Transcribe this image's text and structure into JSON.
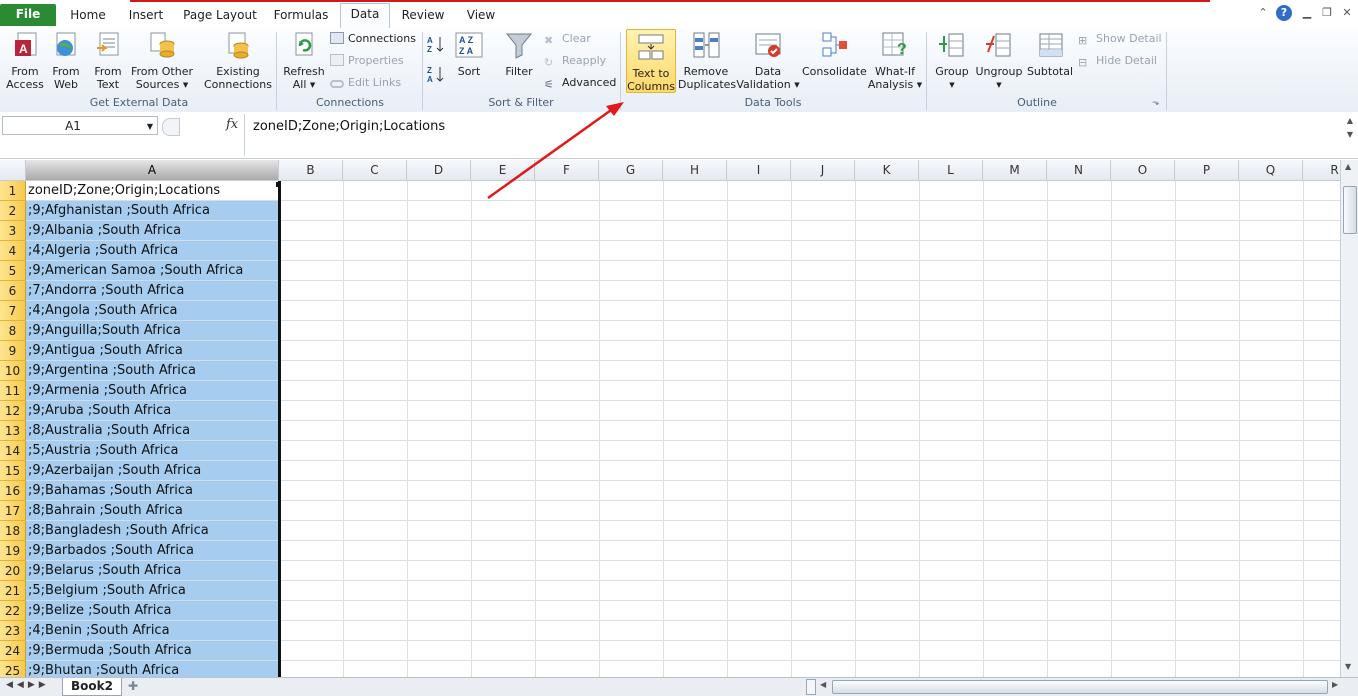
{
  "tabs": [
    {
      "label": "File"
    },
    {
      "label": "Home"
    },
    {
      "label": "Insert"
    },
    {
      "label": "Page Layout"
    },
    {
      "label": "Formulas"
    },
    {
      "label": "Data"
    },
    {
      "label": "Review"
    },
    {
      "label": "View"
    }
  ],
  "ribbon": {
    "external": {
      "from_access_1": "From",
      "from_access_2": "Access",
      "from_web_1": "From",
      "from_web_2": "Web",
      "from_text_1": "From",
      "from_text_2": "Text",
      "from_other_1": "From Other",
      "from_other_2": "Sources",
      "existing_1": "Existing",
      "existing_2": "Connections",
      "label": "Get External Data"
    },
    "connections": {
      "refresh_1": "Refresh",
      "refresh_2": "All",
      "connections": "Connections",
      "properties": "Properties",
      "edit_links": "Edit Links",
      "label": "Connections"
    },
    "sort": {
      "sort": "Sort",
      "filter": "Filter",
      "clear": "Clear",
      "reapply": "Reapply",
      "advanced": "Advanced",
      "label": "Sort & Filter"
    },
    "tools": {
      "ttc_1": "Text to",
      "ttc_2": "Columns",
      "rd_1": "Remove",
      "rd_2": "Duplicates",
      "dv_1": "Data",
      "dv_2": "Validation",
      "consolidate": "Consolidate",
      "wi_1": "What-If",
      "wi_2": "Analysis",
      "label": "Data Tools"
    },
    "outline": {
      "group": "Group",
      "ungroup": "Ungroup",
      "subtotal": "Subtotal",
      "show_detail": "Show Detail",
      "hide_detail": "Hide Detail",
      "label": "Outline"
    }
  },
  "formula_bar": {
    "name_box": "A1",
    "fx": "fx",
    "formula": "zoneID;Zone;Origin;Locations"
  },
  "columns": [
    "A",
    "B",
    "C",
    "D",
    "E",
    "F",
    "G",
    "H",
    "I",
    "J",
    "K",
    "L",
    "M",
    "N",
    "O",
    "P",
    "Q",
    "R"
  ],
  "rows": [
    {
      "n": "1",
      "a": "zoneID;Zone;Origin;Locations"
    },
    {
      "n": "2",
      "a": ";9;Afghanistan ;South Africa"
    },
    {
      "n": "3",
      "a": ";9;Albania ;South Africa"
    },
    {
      "n": "4",
      "a": ";4;Algeria ;South Africa"
    },
    {
      "n": "5",
      "a": ";9;American Samoa ;South Africa"
    },
    {
      "n": "6",
      "a": ";7;Andorra ;South Africa"
    },
    {
      "n": "7",
      "a": ";4;Angola ;South Africa"
    },
    {
      "n": "8",
      "a": ";9;Anguilla;South Africa"
    },
    {
      "n": "9",
      "a": ";9;Antigua ;South Africa"
    },
    {
      "n": "10",
      "a": ";9;Argentina ;South Africa"
    },
    {
      "n": "11",
      "a": ";9;Armenia ;South Africa"
    },
    {
      "n": "12",
      "a": ";9;Aruba ;South Africa"
    },
    {
      "n": "13",
      "a": ";8;Australia ;South Africa"
    },
    {
      "n": "14",
      "a": ";5;Austria ;South Africa"
    },
    {
      "n": "15",
      "a": ";9;Azerbaijan ;South Africa"
    },
    {
      "n": "16",
      "a": ";9;Bahamas ;South Africa"
    },
    {
      "n": "17",
      "a": ";8;Bahrain ;South Africa"
    },
    {
      "n": "18",
      "a": ";8;Bangladesh ;South Africa"
    },
    {
      "n": "19",
      "a": ";9;Barbados ;South Africa"
    },
    {
      "n": "20",
      "a": ";9;Belarus ;South Africa"
    },
    {
      "n": "21",
      "a": ";5;Belgium ;South Africa"
    },
    {
      "n": "22",
      "a": ";9;Belize ;South Africa"
    },
    {
      "n": "23",
      "a": ";4;Benin ;South Africa"
    },
    {
      "n": "24",
      "a": ";9;Bermuda ;South Africa"
    },
    {
      "n": "25",
      "a": ";9;Bhutan ;South Africa"
    }
  ],
  "sheet_tab": "Book2",
  "colors": {
    "file_tab": "#2a8b33",
    "selection": "#a6cdf0",
    "row_header_sel": "#f6c94b",
    "arrow": "#e0191a"
  }
}
